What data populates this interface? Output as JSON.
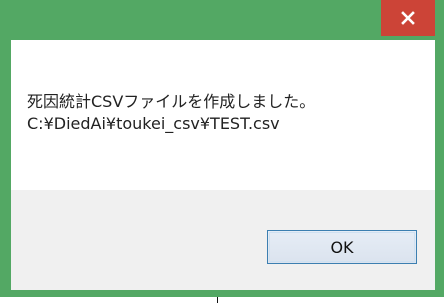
{
  "dialog": {
    "close_icon": "close-x-icon",
    "message_line1": "死因統計CSVファイルを作成しました。",
    "message_line2": "C:¥DiedAi¥toukei_csv¥TEST.csv",
    "ok_label": "OK"
  },
  "colors": {
    "frame": "#53a864",
    "close_button": "#cc4437",
    "content_background": "#ffffff",
    "footer_background": "#f0f0f0",
    "ok_border": "#3c7fb1"
  }
}
